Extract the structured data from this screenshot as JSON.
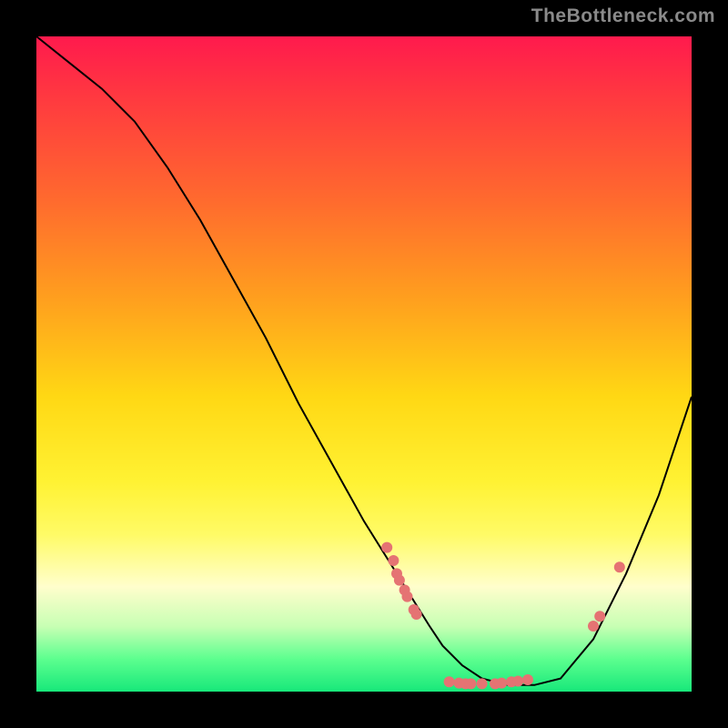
{
  "watermark": "TheBottleneck.com",
  "chart_data": {
    "type": "line",
    "title": "",
    "xlabel": "",
    "ylabel": "",
    "xlim": [
      0,
      100
    ],
    "ylim": [
      0,
      100
    ],
    "series": [
      {
        "name": "curve",
        "x": [
          0,
          5,
          10,
          15,
          20,
          25,
          30,
          35,
          40,
          45,
          50,
          55,
          60,
          62,
          65,
          68,
          72,
          76,
          80,
          85,
          90,
          95,
          100
        ],
        "y": [
          100,
          96,
          92,
          87,
          80,
          72,
          63,
          54,
          44,
          35,
          26,
          18,
          10,
          7,
          4,
          2,
          1,
          1,
          2,
          8,
          18,
          30,
          45
        ]
      }
    ],
    "points": [
      {
        "x": 53.5,
        "y": 22
      },
      {
        "x": 54.5,
        "y": 20
      },
      {
        "x": 55.0,
        "y": 18
      },
      {
        "x": 55.4,
        "y": 17
      },
      {
        "x": 56.2,
        "y": 15.5
      },
      {
        "x": 56.6,
        "y": 14.5
      },
      {
        "x": 57.6,
        "y": 12.5
      },
      {
        "x": 58.0,
        "y": 11.8
      },
      {
        "x": 63.0,
        "y": 1.5
      },
      {
        "x": 64.5,
        "y": 1.3
      },
      {
        "x": 65.5,
        "y": 1.2
      },
      {
        "x": 66.3,
        "y": 1.2
      },
      {
        "x": 68.0,
        "y": 1.2
      },
      {
        "x": 70.0,
        "y": 1.2
      },
      {
        "x": 71.0,
        "y": 1.3
      },
      {
        "x": 72.5,
        "y": 1.5
      },
      {
        "x": 73.5,
        "y": 1.6
      },
      {
        "x": 75.0,
        "y": 1.8
      },
      {
        "x": 85.0,
        "y": 10.0
      },
      {
        "x": 86.0,
        "y": 11.5
      },
      {
        "x": 89.0,
        "y": 19.0
      }
    ]
  }
}
